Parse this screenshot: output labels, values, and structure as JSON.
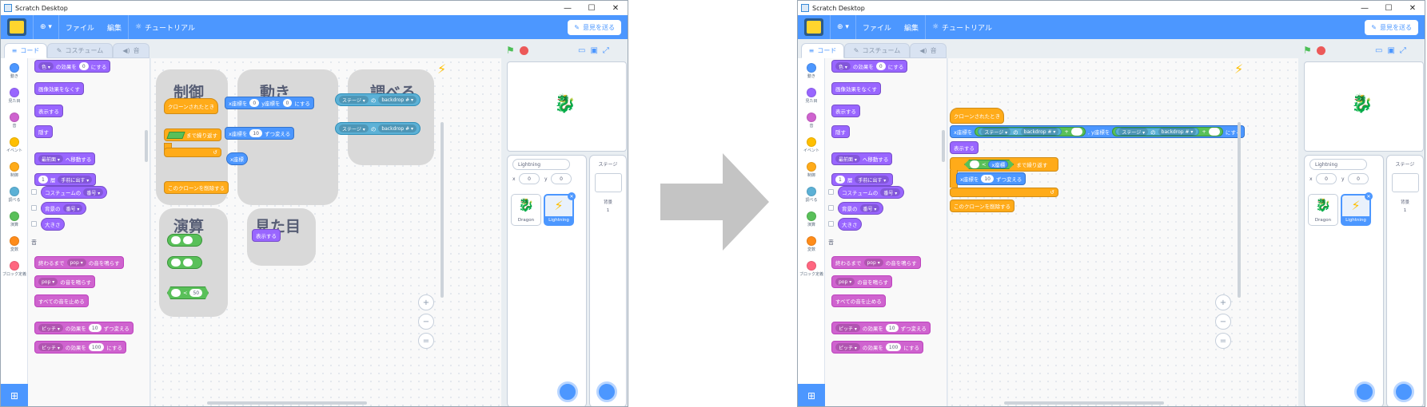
{
  "window_title": "Scratch Desktop",
  "window_controls": {
    "minimize": "—",
    "maximize": "☐",
    "close": "✕"
  },
  "menu": {
    "globe": "⊕ ▾",
    "file": "ファイル",
    "edit": "編集",
    "tutorial": "チュートリアル",
    "feedback": "意見を送る"
  },
  "tabs": {
    "code": "コード",
    "costume": "コスチューム",
    "sound": "音"
  },
  "categories": [
    {
      "label": "動き",
      "color": "#4c97ff"
    },
    {
      "label": "見た目",
      "color": "#9966ff"
    },
    {
      "label": "音",
      "color": "#cf63cf"
    },
    {
      "label": "イベント",
      "color": "#ffbf00"
    },
    {
      "label": "制御",
      "color": "#ffab19"
    },
    {
      "label": "調べる",
      "color": "#5cb1d6"
    },
    {
      "label": "演算",
      "color": "#59c059"
    },
    {
      "label": "変数",
      "color": "#ff8c1a"
    },
    {
      "label": "ブロック定義",
      "color": "#ff6680"
    }
  ],
  "palette": {
    "effect_color": "色 ▾",
    "effect_to": "の効果を",
    "effect_val": "0",
    "effect_suffix": "にする",
    "clear_effects": "画像効果をなくす",
    "show": "表示する",
    "hide": "隠す",
    "go_layer": "最前面 ▾",
    "go_layer_suffix": "へ移動する",
    "layer_num": "1",
    "layer_mid": "層",
    "layer_dd": "手前に出す ▾",
    "costume_label": "コスチュームの",
    "costume_dd": "番号 ▾",
    "backdrop_label": "背景の",
    "backdrop_dd": "番号 ▾",
    "size": "大きさ",
    "sound_section": "音",
    "play_until": "終わるまで",
    "pop": "pop ▾",
    "play_until_suffix": "の音を鳴らす",
    "start_sound_suffix": "の音を鳴らす",
    "stop_all": "すべての音を止める",
    "pitch": "ピッチ ▾",
    "pitch_change": "の効果を",
    "pitch_change_val": "10",
    "pitch_change_suffix": "ずつ変える",
    "pitch_set_val": "100",
    "pitch_set_suffix": "にする"
  },
  "left_workspace": {
    "groups": {
      "control": "制御",
      "motion": "動き",
      "sensing": "調べる",
      "operators": "演算",
      "looks": "見た目"
    },
    "clone_hat": "クローンされたとき",
    "repeat_until": "まで繰り返す",
    "delete_clone": "このクローンを削除する",
    "goto_x": "x座標を",
    "goto_x_val": "0",
    "goto_y": "y座標を",
    "goto_y_val": "0",
    "goto_suffix": "にする",
    "change_x": "x座標を",
    "change_x_val": "10",
    "change_x_suffix": "ずつ変える",
    "x_pos": "x座標",
    "of_stage": "ステージ ▾",
    "of_mid": "の",
    "of_backdrop": "backdrop # ▾",
    "lt_val": "50",
    "show": "表示する",
    "repeat_arrow": "↺"
  },
  "right_workspace": {
    "clone_hat": "クローンされたとき",
    "goto_x": "x座標を",
    "of_stage": "ステージ ▾",
    "of_mid": "の",
    "of_backdrop": "backdrop # ▾",
    "plus": "+",
    "goto_y": ", y座標を",
    "goto_suffix": "にする",
    "show": "表示する",
    "lt": "<",
    "x_pos": "x座標",
    "repeat_until": "まで繰り返す",
    "change_x": "x座標を",
    "change_x_val": "10",
    "change_x_suffix": "ずつ変える",
    "delete_clone": "このクローンを削除する",
    "repeat_arrow": "↺"
  },
  "sprite_info": {
    "name": "Lightning",
    "x_label": "x",
    "x": "0",
    "y_label": "y",
    "y": "0"
  },
  "sprites": [
    {
      "name": "Dragon"
    },
    {
      "name": "Lightning"
    }
  ],
  "stage_pane": {
    "title": "ステージ",
    "backdrops_label": "背景",
    "backdrops_count": "1"
  },
  "zoom": {
    "in": "+",
    "out": "−",
    "reset": "="
  },
  "colors": {
    "accent": "#4c97ff",
    "looks": "#9966ff",
    "sound": "#cf63cf",
    "control": "#ffab19",
    "motion": "#4c97ff",
    "sensing": "#5cb1d6",
    "operators": "#59c059"
  }
}
